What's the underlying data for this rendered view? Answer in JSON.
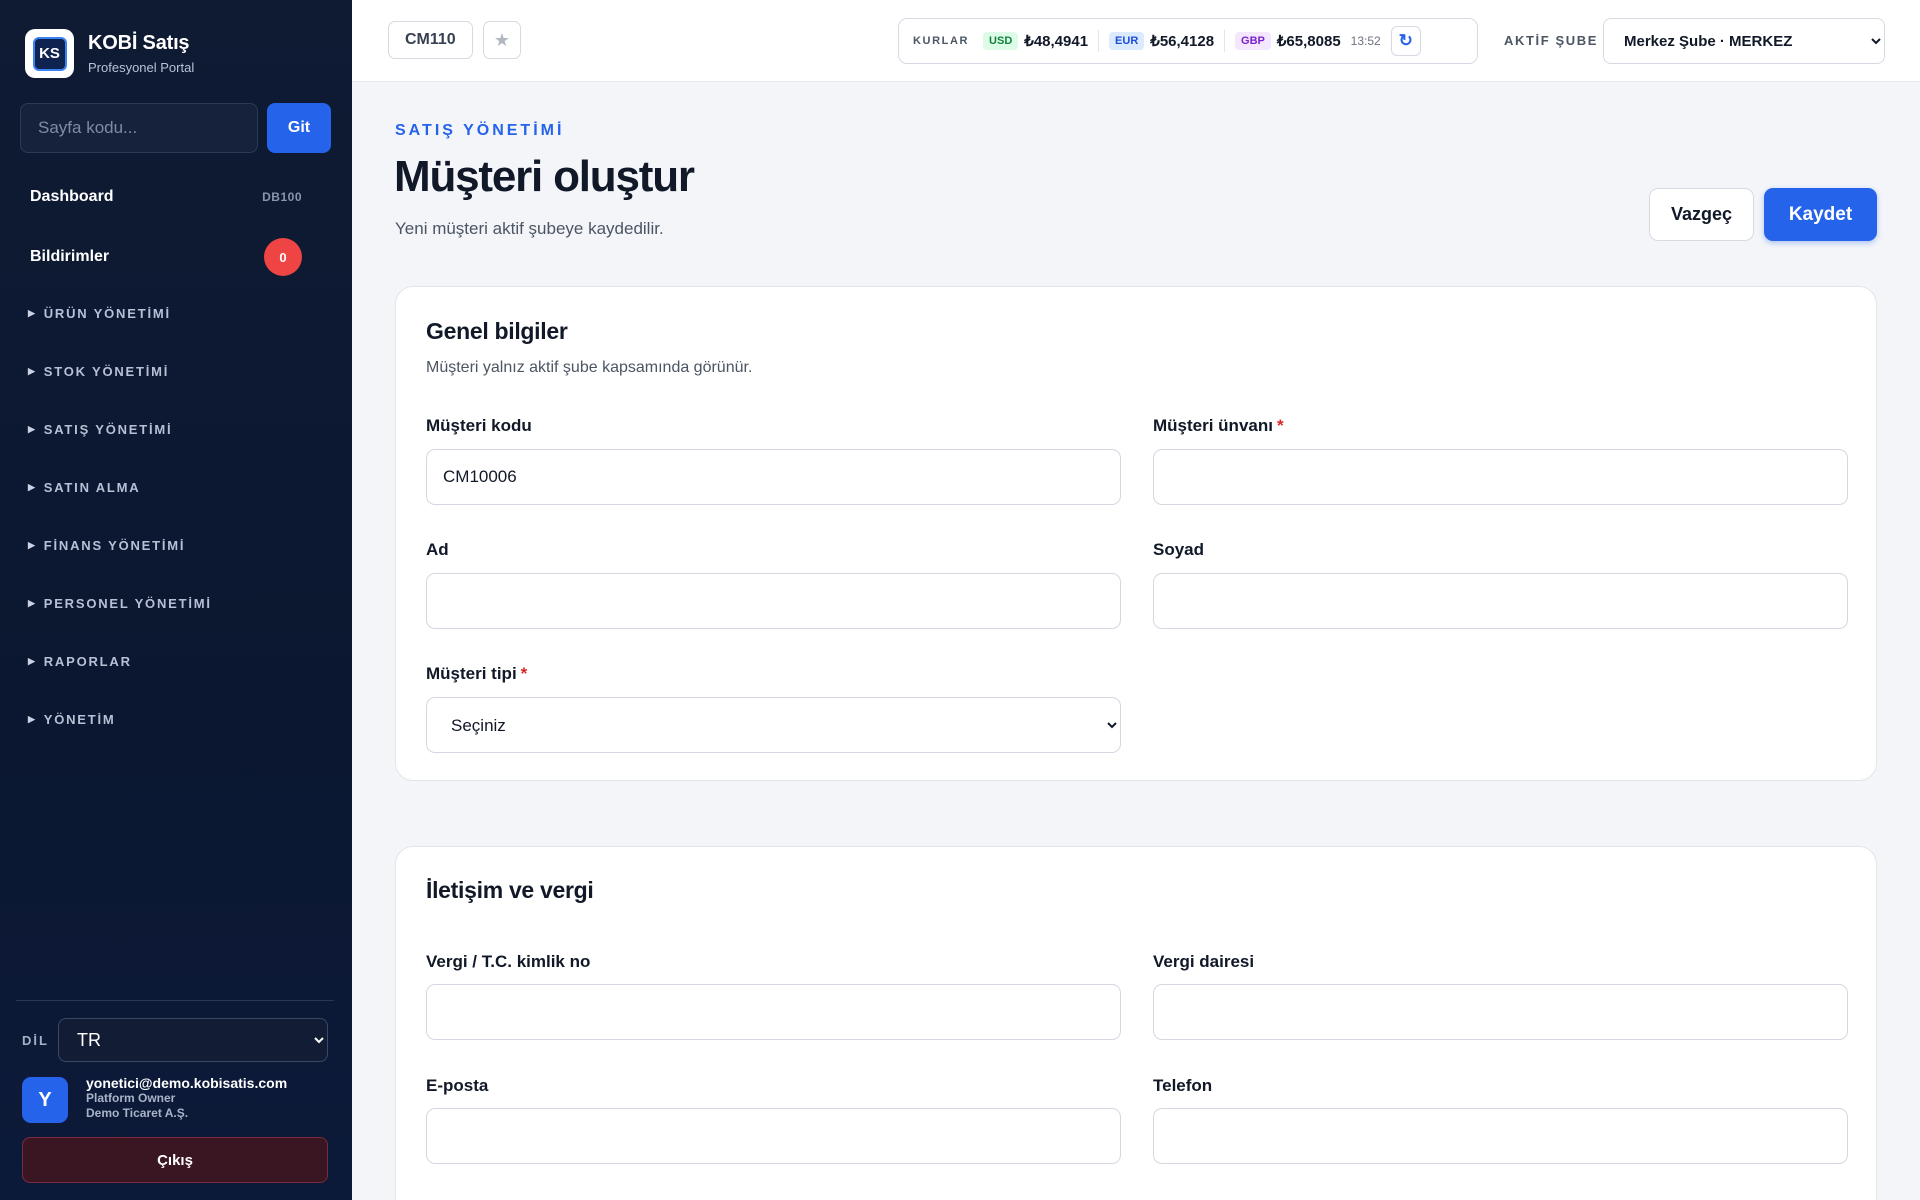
{
  "sidebar": {
    "brand_title": "KOBİ Satış",
    "brand_subtitle": "Profesyonel Portal",
    "logo_text": "KS",
    "page_code_placeholder": "Sayfa kodu...",
    "go_label": "Git",
    "dashboard_label": "Dashboard",
    "dashboard_code": "DB100",
    "notifications_label": "Bildirimler",
    "notifications_count": "0",
    "groups": [
      "ÜRÜN YÖNETİMİ",
      "STOK YÖNETİMİ",
      "SATIŞ YÖNETİMİ",
      "SATIN ALMA",
      "FİNANS YÖNETİMİ",
      "PERSONEL YÖNETİMİ",
      "RAPORLAR",
      "YÖNETİM"
    ],
    "language_label": "DİL",
    "language_value": "TR",
    "user_initial": "Y",
    "user_email": "yonetici@demo.kobisatis.com",
    "user_role": "Platform Owner",
    "user_company": "Demo Ticaret A.Ş.",
    "logout_label": "Çıkış"
  },
  "topbar": {
    "page_code": "CM110",
    "rates_label": "KURLAR",
    "rates": [
      {
        "currency": "USD",
        "value": "₺48,4941"
      },
      {
        "currency": "EUR",
        "value": "₺56,4128"
      },
      {
        "currency": "GBP",
        "value": "₺65,8085"
      }
    ],
    "rates_time": "13:52",
    "branch_label": "AKTİF ŞUBE",
    "branch_value": "Merkez Şube · MERKEZ"
  },
  "main": {
    "kicker": "SATIŞ YÖNETİMİ",
    "title": "Müşteri oluştur",
    "description": "Yeni müşteri aktif şubeye kaydedilir.",
    "cancel_label": "Vazgeç",
    "save_label": "Kaydet"
  },
  "general": {
    "title": "Genel bilgiler",
    "subtitle": "Müşteri yalnız aktif şube kapsamında görünür.",
    "customer_code_label": "Müşteri kodu",
    "customer_code_value": "CM10006",
    "customer_title_label": "Müşteri ünvanı",
    "first_name_label": "Ad",
    "last_name_label": "Soyad",
    "customer_type_label": "Müşteri tipi",
    "customer_type_value": "Seçiniz",
    "required_mark": "*"
  },
  "contact": {
    "title": "İletişim ve vergi",
    "tax_id_label": "Vergi / T.C. kimlik no",
    "tax_office_label": "Vergi dairesi",
    "email_label": "E-posta",
    "phone_label": "Telefon"
  },
  "colors": {
    "accent": "#2563eb",
    "sidebar_bg": "#0f1a33",
    "danger": "#ef4444"
  }
}
